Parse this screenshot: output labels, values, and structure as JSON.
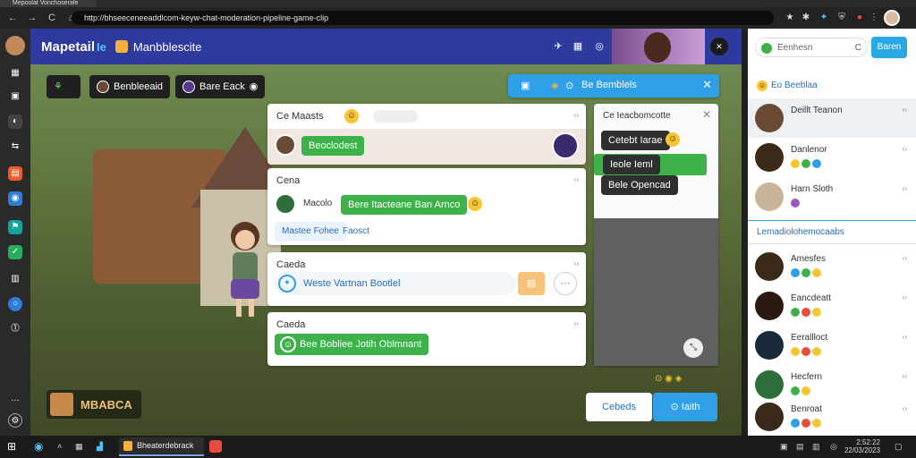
{
  "browser": {
    "tab_title": "Mepoolat Vonchoserafe",
    "url": "http://bhseeceneeaddlcom-keyw-chat-moderation-pipeline-game-clip",
    "nav": {
      "back": "←",
      "forward": "→",
      "reload": "C",
      "home": "⌂"
    }
  },
  "app": {
    "brand": "Mapetail",
    "brand_suffix": "Ie",
    "subtitle": "Manbblescite",
    "header_icons": [
      "pin-icon",
      "grid-icon",
      "at-icon"
    ],
    "header_dark_label": "✕"
  },
  "chips": [
    {
      "label": "",
      "icon": "leaf-icon"
    },
    {
      "label": "Benbleeaid",
      "icon": "avatar"
    },
    {
      "label": "Bare Eack",
      "icon": "avatar"
    }
  ],
  "notice": {
    "label": "Be Bemblels",
    "close": "✕"
  },
  "panels": [
    {
      "title": "Ce Maasts",
      "meta": "‹›",
      "items": [
        {
          "type": "pill",
          "label": "Beoclodest",
          "color": "green"
        }
      ]
    },
    {
      "title": "Cena",
      "meta": "‹›",
      "row_label": "Macolo",
      "pill": "Bere Itacteane Ban Arnco",
      "sub1": "Mastee Fohee",
      "sub2": "Faosct"
    },
    {
      "title": "Caeda",
      "meta": "‹›",
      "input": "Weste Vartnan Bootlel"
    },
    {
      "title": "Caeda",
      "meta": "‹›",
      "pill": "Bee Bobliee Jotih Oblmnant"
    }
  ],
  "side_panel": {
    "title": "Ce Ieacbomcotte",
    "items": [
      {
        "label": "Cetebt Iarae",
        "color": "dark"
      },
      {
        "label": "Ieole Ieml",
        "color": "dark"
      },
      {
        "label": "Bele Opencad",
        "color": "dark"
      }
    ]
  },
  "footer": {
    "logo_text": "MBABCA",
    "badges": "⊙ ◉ ◈",
    "btn_secondary": "Cebeds",
    "btn_primary": "⊙ Iaith"
  },
  "right_panel": {
    "search_placeholder": "Eenhesn",
    "button": "Baren",
    "section1": "Eo Beeblaa",
    "contacts_top": [
      {
        "name": "Deillt Teanon",
        "time": "‹›"
      },
      {
        "name": "Danlenor",
        "time": "‹›"
      },
      {
        "name": "Harn Sloth",
        "time": "‹›"
      }
    ],
    "section2": "Lemadiolohemocaabs",
    "contacts_bottom": [
      {
        "name": "Amesfes",
        "time": "‹›"
      },
      {
        "name": "Eancdeatt",
        "time": "‹›"
      },
      {
        "name": "Eerallloct",
        "time": "‹›"
      },
      {
        "name": "Hecfern",
        "time": "‹›"
      },
      {
        "name": "Benroat",
        "time": "‹›"
      }
    ]
  },
  "taskbar": {
    "app_label": "Bheaterdebrack",
    "time": "2:52:22",
    "date": "22/03/2023"
  },
  "colors": {
    "header_blue": "#2e3a9e",
    "accent_green": "#3db24a",
    "accent_blue": "#2f9fe8"
  }
}
